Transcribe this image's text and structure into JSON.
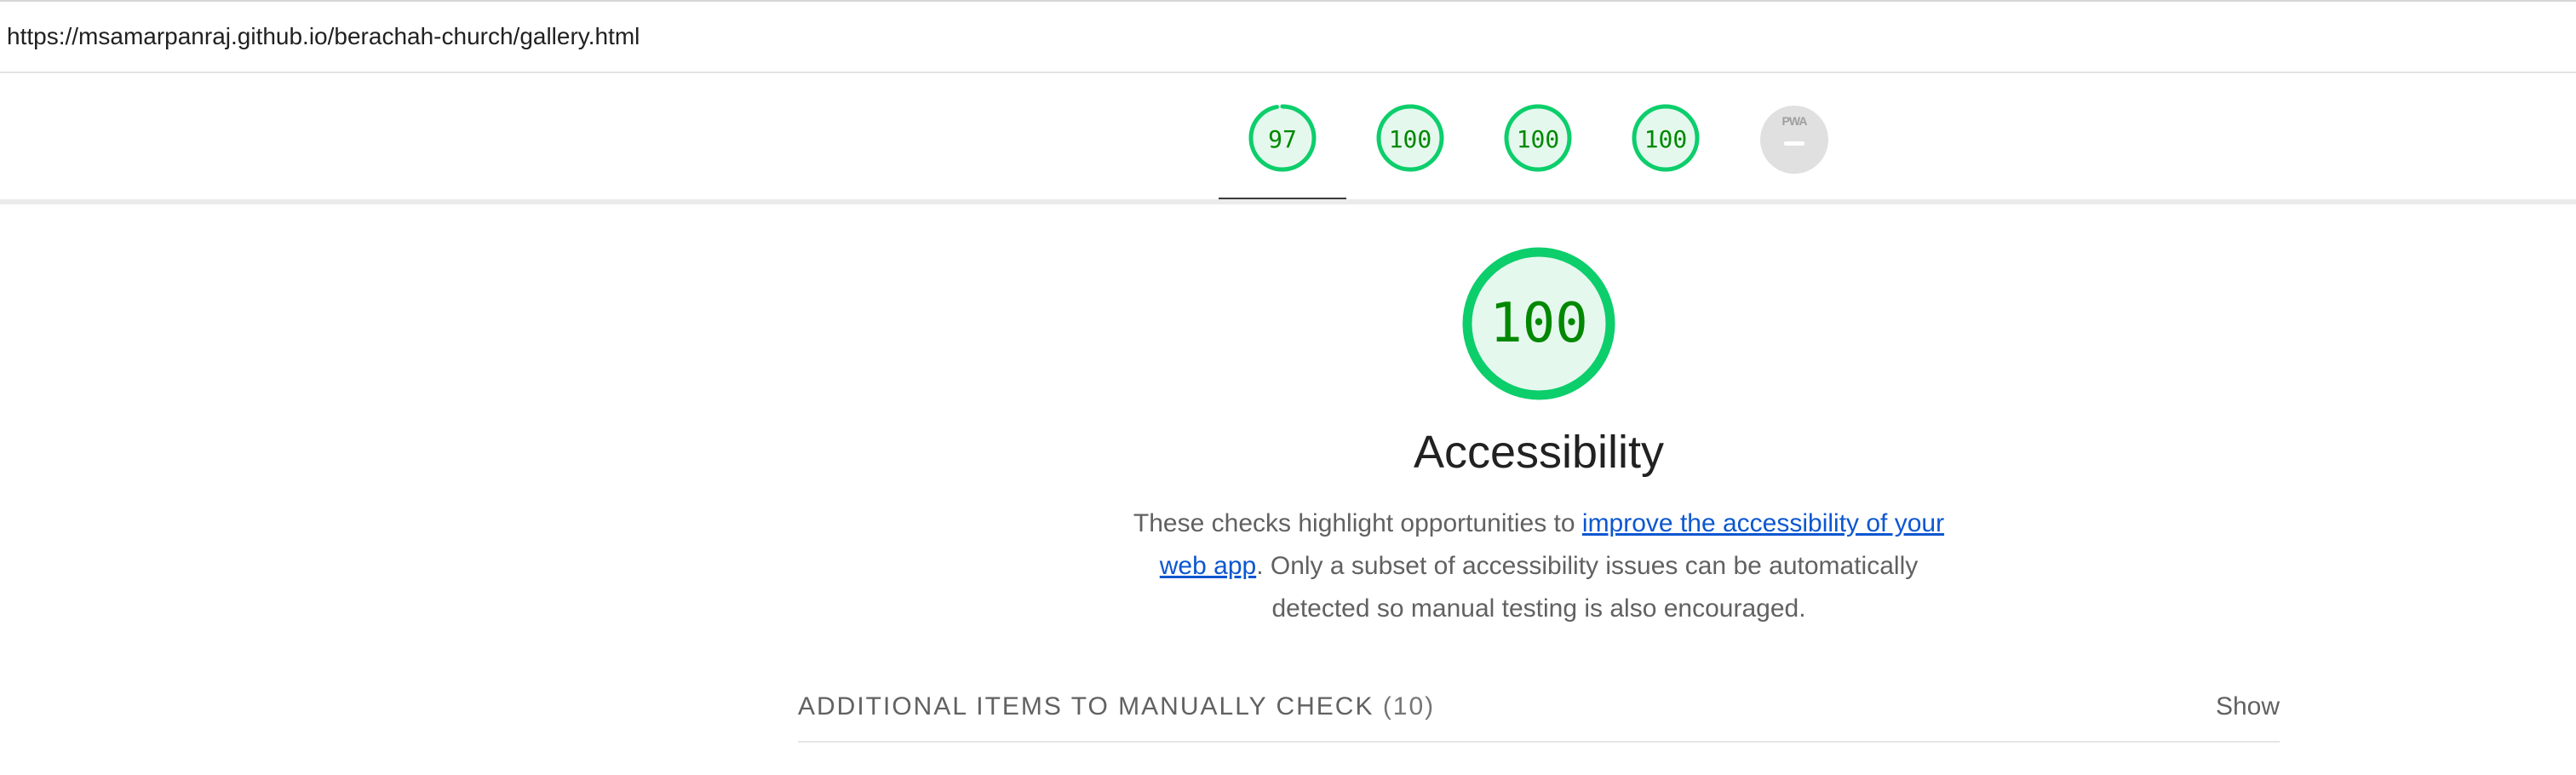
{
  "url": "https://msamarpanraj.github.io/berachah-church/gallery.html",
  "gauges": [
    {
      "score": "97",
      "fraction": 0.97,
      "color": "#0cce6b"
    },
    {
      "score": "100",
      "fraction": 1.0,
      "color": "#0cce6b"
    },
    {
      "score": "100",
      "fraction": 1.0,
      "color": "#0cce6b"
    },
    {
      "score": "100",
      "fraction": 1.0,
      "color": "#0cce6b"
    }
  ],
  "pwa": {
    "label": "PWA",
    "color": "#e0e0e0"
  },
  "category": {
    "score": "100",
    "fraction": 1.0,
    "title": "Accessibility",
    "desc_before": "These checks highlight opportunities to ",
    "link_text": "improve the accessibility of your web app",
    "desc_after": ". Only a subset of accessibility issues can be automatically detected so manual testing is also encouraged."
  },
  "manual": {
    "title": "ADDITIONAL ITEMS TO MANUALLY CHECK",
    "count": "(10)",
    "show_label": "Show"
  },
  "colors": {
    "pass": "#0cce6b",
    "pass_fill": "#e5f8ee",
    "pass_text": "#008800",
    "link": "#0b57d0"
  }
}
